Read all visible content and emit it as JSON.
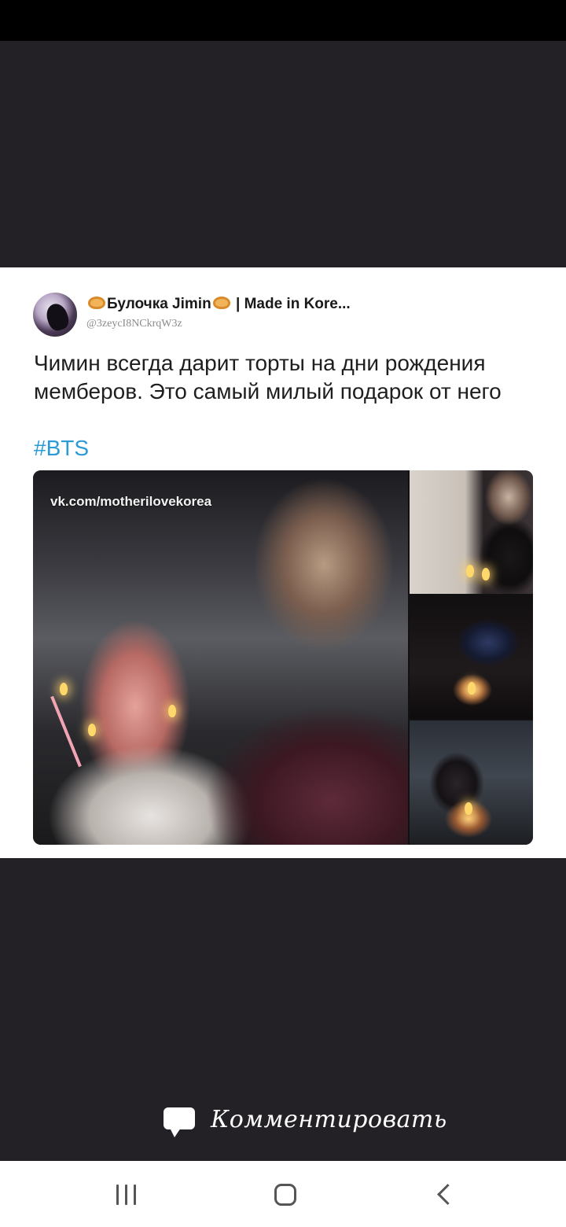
{
  "tweet": {
    "display_name_before": "Булочка Jimin",
    "display_name_after": "| Made in Kore...",
    "handle": "@3zeycI8NCkrqW3z",
    "text": "Чимин всегда дарит торты на дни рождения мемберов. Это самый милый подарок от него",
    "hashtag": "#BTS",
    "media": {
      "watermark": "vk.com/motherilovekorea",
      "photo_count": 4
    }
  },
  "comment_bar": {
    "icon": "speech-bubble-icon",
    "label": "Комментировать"
  },
  "nav": {
    "recents_icon": "recent-apps-icon",
    "home_icon": "home-icon",
    "back_icon": "back-icon"
  },
  "colors": {
    "background": "#232125",
    "hashtag": "#2a9bd6",
    "card": "#ffffff"
  }
}
